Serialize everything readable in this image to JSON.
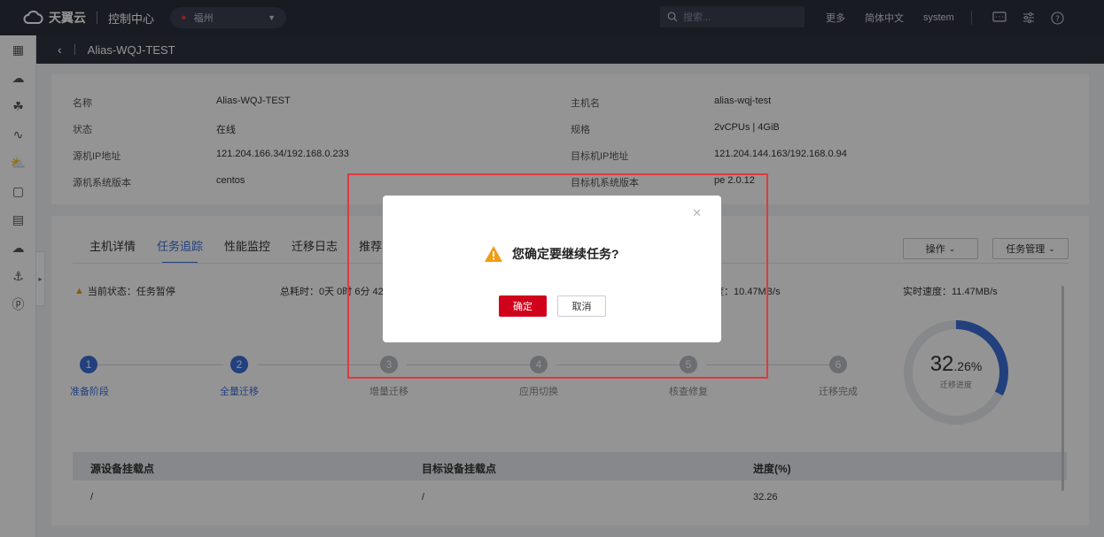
{
  "topbar": {
    "brand": "天翼云",
    "console": "控制中心",
    "region": "福州",
    "search_placeholder": "搜索...",
    "links": [
      "更多",
      "简体中文",
      "system"
    ]
  },
  "subheader": {
    "title": "Alias-WQJ-TEST"
  },
  "info": {
    "left": [
      {
        "k": "名称",
        "v": "Alias-WQJ-TEST"
      },
      {
        "k": "状态",
        "v": "在线"
      },
      {
        "k": "源机IP地址",
        "v": "121.204.166.34/192.168.0.233"
      },
      {
        "k": "源机系统版本",
        "v": "centos"
      }
    ],
    "right": [
      {
        "k": "主机名",
        "v": "alias-wqj-test"
      },
      {
        "k": "规格",
        "v": "2vCPUs | 4GiB"
      },
      {
        "k": "目标机IP地址",
        "v": "121.204.144.163/192.168.0.94"
      },
      {
        "k": "目标机系统版本",
        "v": "pe 2.0.12"
      }
    ]
  },
  "tabs": [
    "主机详情",
    "任务追踪",
    "性能监控",
    "迁移日志",
    "推荐目标机"
  ],
  "active_tab": "任务追踪",
  "actions": {
    "operate": "操作",
    "task_manage": "任务管理"
  },
  "status": {
    "current": "当前状态：任务暂停",
    "elapsed": "总耗时：0天 0时 6分 42 秒",
    "avg_speed": "度：10.47MB/s",
    "realtime_speed": "实时速度：11.47MB/s"
  },
  "steps": [
    {
      "num": "1",
      "label": "准备阶段",
      "done": true
    },
    {
      "num": "2",
      "label": "全量迁移",
      "done": true
    },
    {
      "num": "3",
      "label": "增量迁移",
      "done": false
    },
    {
      "num": "4",
      "label": "应用切换",
      "done": false
    },
    {
      "num": "5",
      "label": "核查修复",
      "done": false
    },
    {
      "num": "6",
      "label": "迁移完成",
      "done": false
    }
  ],
  "progress": {
    "int": "32",
    "dec": ".26%",
    "label": "迁移进度",
    "value_pct": 32.26
  },
  "table": {
    "headers": [
      "源设备挂载点",
      "目标设备挂载点",
      "进度(%)"
    ],
    "row": [
      "/",
      "/",
      "32.26"
    ]
  },
  "dialog": {
    "message": "您确定要继续任务?",
    "confirm": "确定",
    "cancel": "取消"
  },
  "colors": {
    "accent": "#3b6fd8",
    "danger": "#d0021b",
    "warning": "#f39c12"
  }
}
